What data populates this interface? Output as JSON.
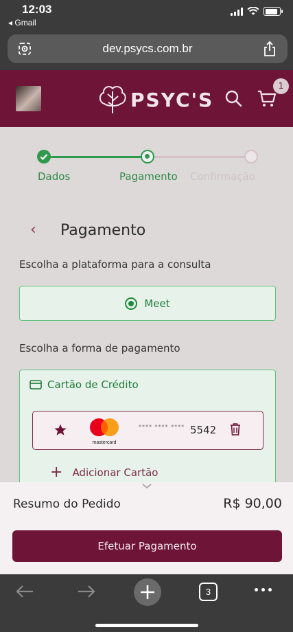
{
  "status": {
    "time": "12:03",
    "back_app": "◂ Gmail",
    "battery_level": 0.85
  },
  "browser": {
    "url": "dev.psycs.com.br",
    "tab_count": "3"
  },
  "header": {
    "logo": "PSYC'S",
    "cart_count": "1"
  },
  "stepper": {
    "steps": [
      {
        "label": "Dados",
        "state": "done"
      },
      {
        "label": "Pagamento",
        "state": "current"
      },
      {
        "label": "Confirmação",
        "state": "pending"
      }
    ]
  },
  "page": {
    "title": "Pagamento",
    "back_glyph": "‹",
    "platform_prompt": "Escolha a plataforma para a consulta",
    "platform_selected": "Meet",
    "payment_prompt": "Escolha a forma de pagamento",
    "payment_method": "Cartão de Crédito",
    "card": {
      "mask": "**** **** ****",
      "last4": "5542",
      "brand": "mastercard"
    },
    "add_card": "Adicionar Cartão"
  },
  "summary": {
    "label": "Resumo do Pedido",
    "total": "R$ 90,00",
    "button": "Efetuar Pagamento"
  },
  "colors": {
    "brand": "#6e1436",
    "success": "#1f8a3e",
    "background": "#ddd9d9"
  }
}
